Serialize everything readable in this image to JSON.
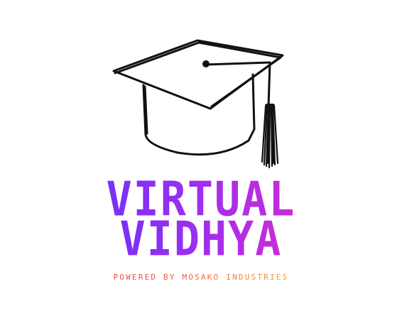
{
  "logo": {
    "icon": "graduation-cap-icon",
    "brand_line_1": "VIRTUAL",
    "brand_line_2": "VIDHYA",
    "tagline": "POWERED BY MOSAKO INDUSTRIES",
    "colors": {
      "background": "#ffffff",
      "cap_stroke": "#111111",
      "brand_gradient_start": "#7b2ff7",
      "brand_gradient_end": "#c92bd8",
      "tagline_gradient_start": "#e2483f",
      "tagline_gradient_end": "#e8a23a"
    }
  }
}
